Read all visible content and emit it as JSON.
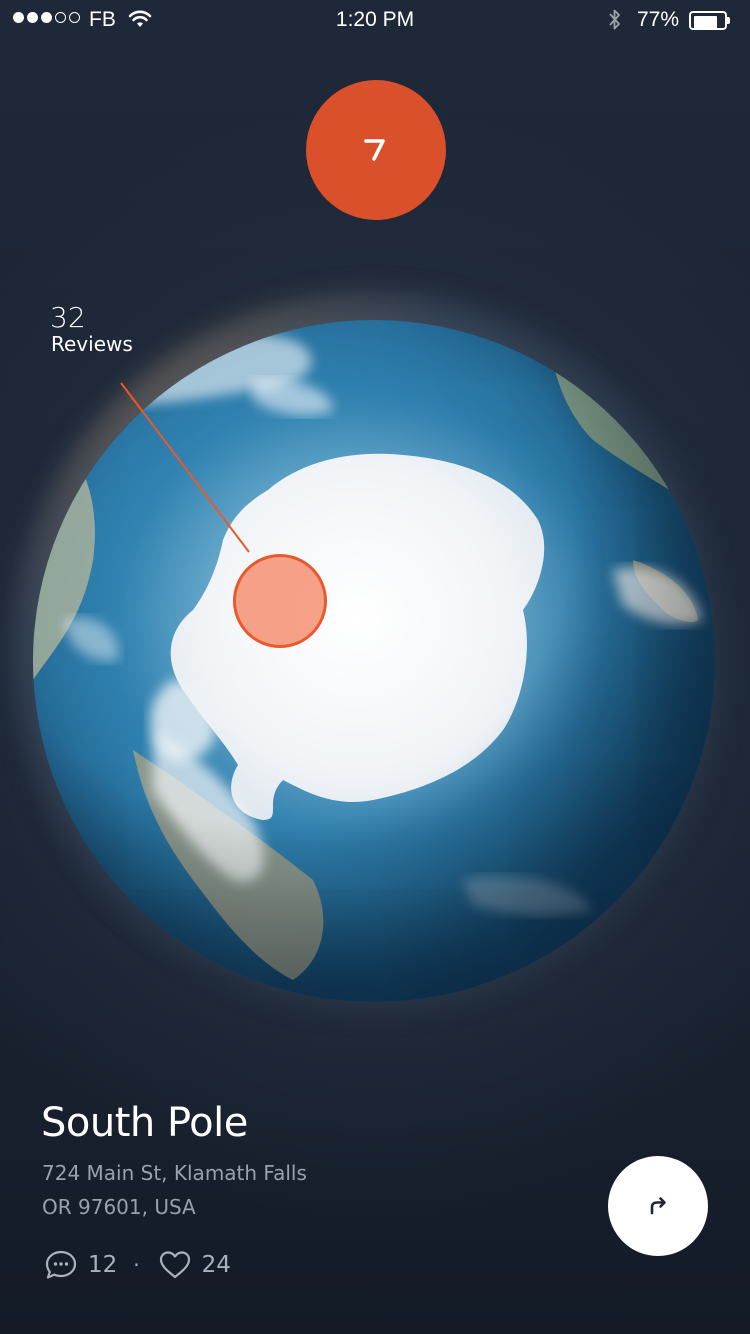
{
  "status_bar": {
    "carrier": "FB",
    "time": "1:20 PM",
    "battery_percent": "77%",
    "signal_bars_filled": 3,
    "signal_bars_total": 5,
    "battery_level": 0.77
  },
  "logo": {
    "glyph": "7",
    "color": "#d9502b"
  },
  "globe_callout": {
    "count": "32",
    "label": "Reviews",
    "marker_color": "#e85a2c"
  },
  "place": {
    "title": "South Pole",
    "address_line1": "724 Main St, Klamath Falls",
    "address_line2": "OR 97601, USA"
  },
  "stats": {
    "comments": "12",
    "separator": "·",
    "likes": "24"
  },
  "actions": {
    "share_icon": "share-arrow-icon"
  }
}
